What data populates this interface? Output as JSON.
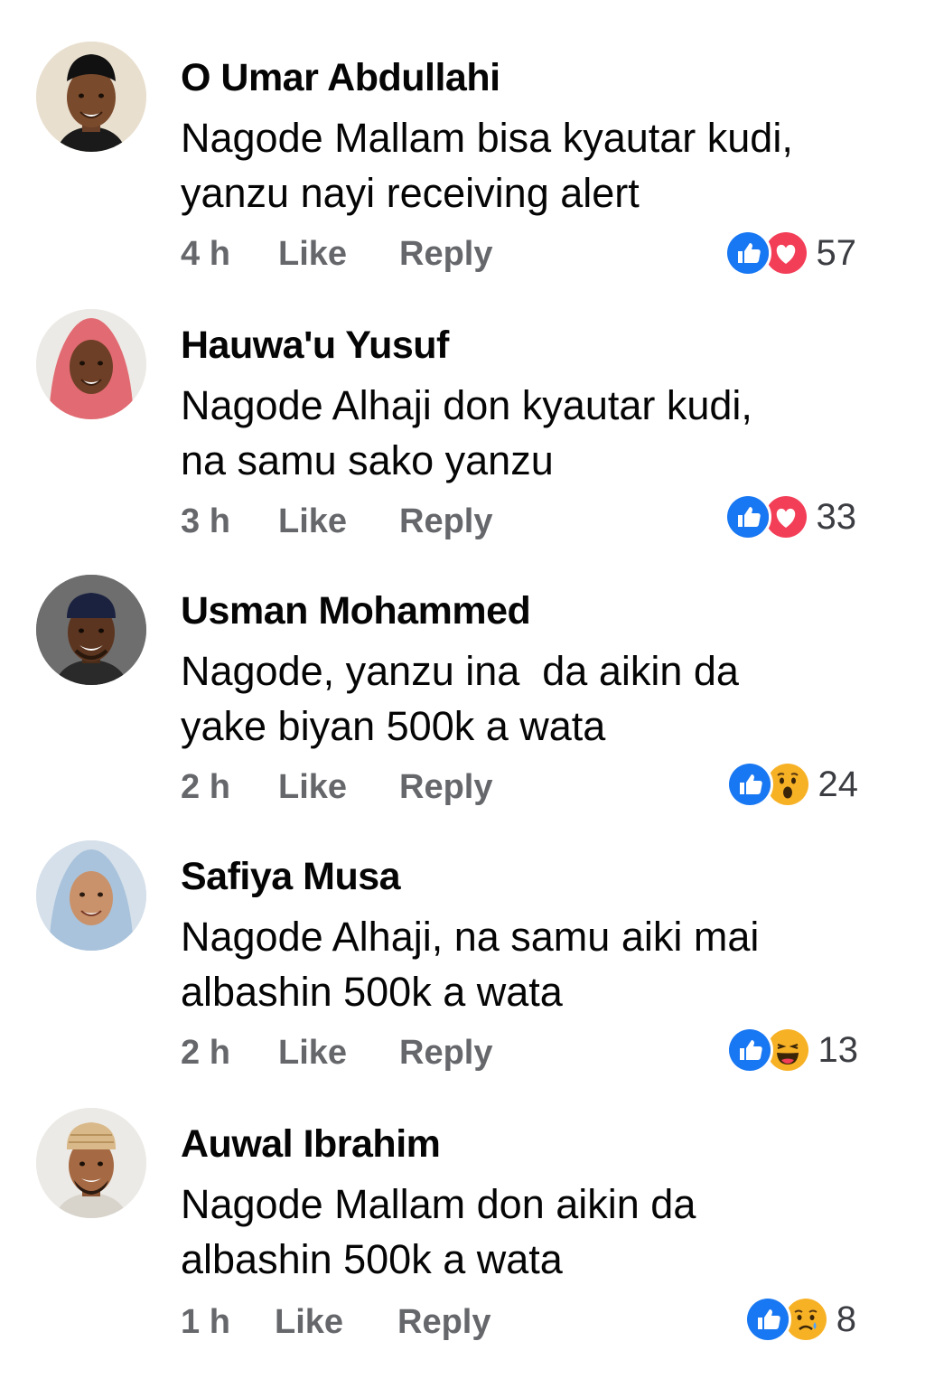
{
  "comments": [
    {
      "name": "O Umar Abdullahi",
      "text_lines": [
        "Nagode Mallam bisa kyautar kudi,",
        "yanzu nayi receiving alert"
      ],
      "time": "4 h",
      "like_label": "Like",
      "reply_label": "Reply",
      "reactions": [
        "like-icon",
        "love-icon"
      ],
      "reaction_count": "57",
      "avatar": "avatar-man-black-cap"
    },
    {
      "name": "Hauwa'u Yusuf",
      "text_lines": [
        "Nagode Alhaji don kyautar kudi,",
        "na samu sako yanzu"
      ],
      "time": "3 h",
      "like_label": "Like",
      "reply_label": "Reply",
      "reactions": [
        "like-icon",
        "love-icon"
      ],
      "reaction_count": "33",
      "avatar": "avatar-woman-pink-hijab"
    },
    {
      "name": "Usman Mohammed",
      "text_lines": [
        "Nagode, yanzu ina  da aikin da",
        "yake biyan 500k a wata"
      ],
      "time": "2 h",
      "like_label": "Like",
      "reply_label": "Reply",
      "reactions": [
        "like-icon",
        "wow-icon"
      ],
      "reaction_count": "24",
      "avatar": "avatar-man-navy-cap"
    },
    {
      "name": "Safiya Musa",
      "text_lines": [
        "Nagode Alhaji, na samu aiki mai",
        "albashin 500k a wata"
      ],
      "time": "2 h",
      "like_label": "Like",
      "reply_label": "Reply",
      "reactions": [
        "like-icon",
        "haha-icon"
      ],
      "reaction_count": "13",
      "avatar": "avatar-woman-blue-hijab"
    },
    {
      "name": "Auwal Ibrahim",
      "text_lines": [
        "Nagode Mallam don aikin da",
        "albashin 500k a wata"
      ],
      "time": "1 h",
      "like_label": "Like",
      "reply_label": "Reply",
      "reactions": [
        "like-icon",
        "sad-icon"
      ],
      "reaction_count": "8",
      "avatar": "avatar-man-embroidered-cap"
    }
  ],
  "colors": {
    "like_blue": "#1877f2",
    "love_red": "#f33e58",
    "reaction_yellow": "#f7b125",
    "meta_gray": "#65676b"
  }
}
